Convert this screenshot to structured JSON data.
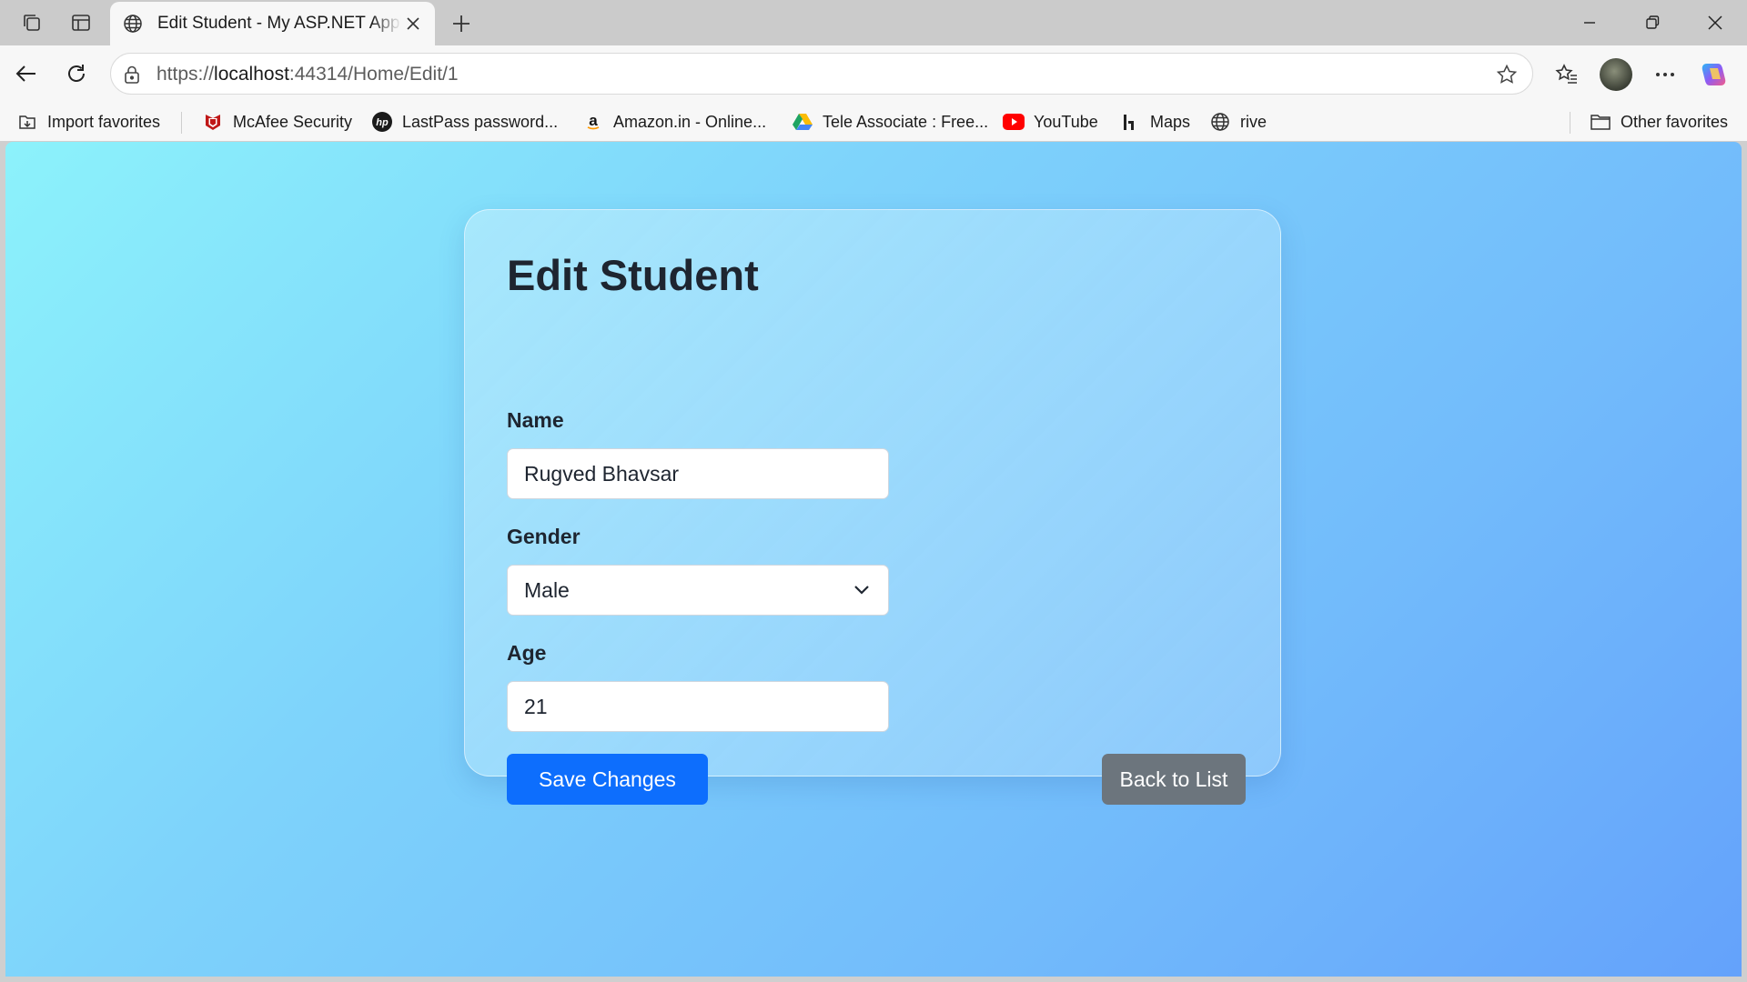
{
  "browser": {
    "tab_title": "Edit Student - My ASP.NET Application",
    "url_prefix": "https://",
    "url_host": "localhost",
    "url_rest": ":44314/Home/Edit/1"
  },
  "favorites": {
    "items": [
      {
        "label": "Import favorites",
        "icon": "import-favorites-icon"
      },
      {
        "label": "McAfee Security",
        "icon": "mcafee-icon"
      },
      {
        "label": "LastPass password...",
        "icon": "hp-icon"
      },
      {
        "label": "Amazon.in - Online...",
        "icon": "amazon-icon"
      },
      {
        "label": "Tele Associate : Free...",
        "icon": "google-drive-icon"
      },
      {
        "label": "YouTube",
        "icon": "youtube-icon"
      },
      {
        "label": "Maps",
        "icon": "maps-icon"
      },
      {
        "label": "rive",
        "icon": "globe-icon"
      }
    ],
    "other_label": "Other favorites"
  },
  "form": {
    "heading": "Edit Student",
    "name_label": "Name",
    "name_value": "Rugved Bhavsar",
    "gender_label": "Gender",
    "gender_value": "Male",
    "age_label": "Age",
    "age_value": "21",
    "save_label": "Save Changes",
    "back_label": "Back to List"
  },
  "colors": {
    "primary": "#0d6efd",
    "secondary": "#6c757d",
    "gradient_start": "#8cf2fb",
    "gradient_end": "#64a2fb"
  }
}
